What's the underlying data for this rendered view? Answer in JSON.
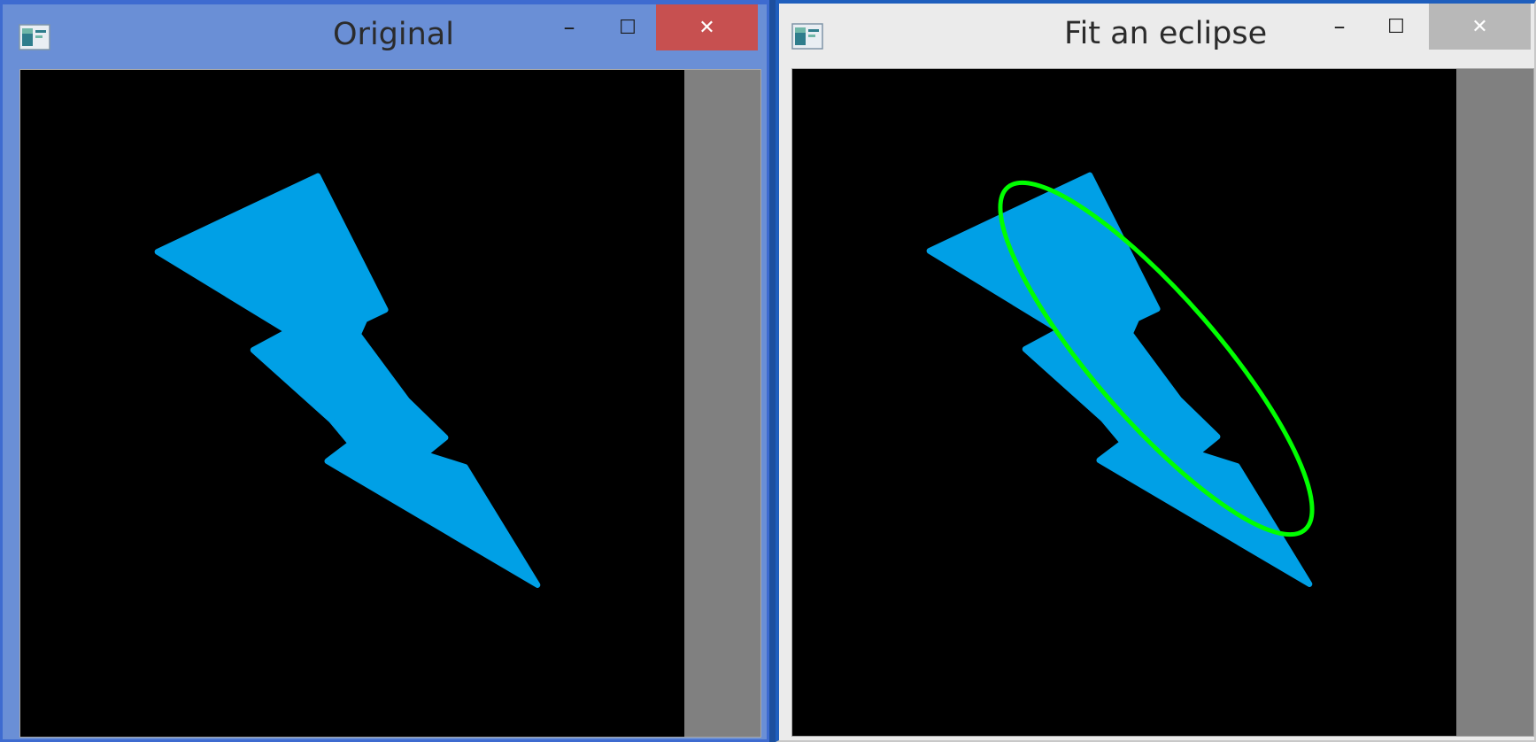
{
  "windows": {
    "original": {
      "title": "Original",
      "minimize_label": "–",
      "maximize_label": "☐",
      "close_label": "✕"
    },
    "fit": {
      "title": "Fit an eclipse",
      "minimize_label": "–",
      "maximize_label": "☐",
      "close_label": "✕"
    }
  },
  "icons": {
    "app": "app-window-icon",
    "minimize": "minimize-icon",
    "maximize": "maximize-icon",
    "close": "close-icon"
  },
  "colors": {
    "original_frame": "#6a8fd6",
    "fit_frame": "#ebebeb",
    "close_active": "#c75050",
    "close_inactive": "#b8b8b8",
    "canvas_background": "#000000",
    "canvas_padding": "#808080",
    "shape_fill": "#00a0e6",
    "ellipse_stroke": "#00ff00"
  }
}
